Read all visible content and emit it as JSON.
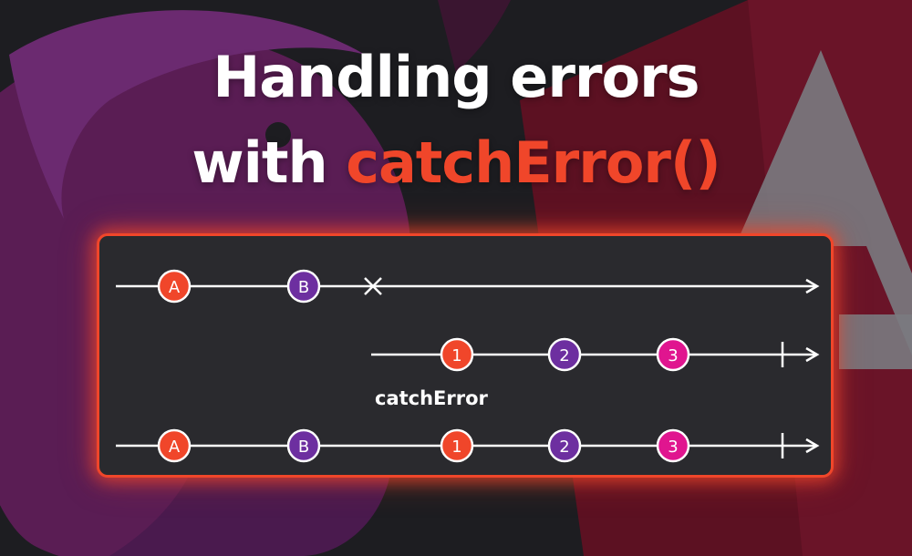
{
  "title": {
    "line1": "Handling errors",
    "line2_prefix": "with ",
    "line2_accent": "catchError()"
  },
  "colors": {
    "accent": "#f0462a",
    "marble_orange": "#f0462a",
    "marble_purple": "#6d2fa0",
    "marble_magenta": "#e0158f",
    "panel": "#2a2a2e",
    "line": "#ffffff"
  },
  "diagram": {
    "operator_label": "catchError",
    "source_stream": {
      "marbles": [
        {
          "label": "A",
          "color": "orange"
        },
        {
          "label": "B",
          "color": "purple"
        }
      ],
      "terminator": "error"
    },
    "fallback_stream": {
      "marbles": [
        {
          "label": "1",
          "color": "orange"
        },
        {
          "label": "2",
          "color": "purple"
        },
        {
          "label": "3",
          "color": "magenta"
        }
      ],
      "terminator": "complete"
    },
    "output_stream": {
      "marbles": [
        {
          "label": "A",
          "color": "orange"
        },
        {
          "label": "B",
          "color": "purple"
        },
        {
          "label": "1",
          "color": "orange"
        },
        {
          "label": "2",
          "color": "purple"
        },
        {
          "label": "3",
          "color": "magenta"
        }
      ],
      "terminator": "complete"
    }
  }
}
